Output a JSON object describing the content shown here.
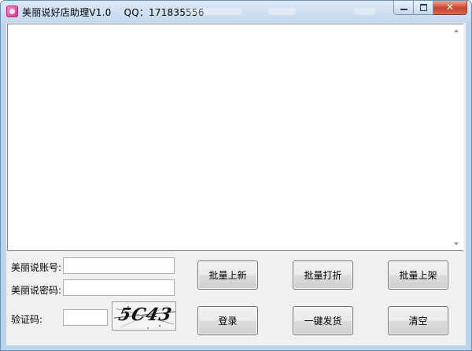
{
  "window": {
    "title": "美丽说好店助理V1.0    QQ：171835556",
    "controls": {
      "minimize": "minimize",
      "maximize": "maximize",
      "close": "✕"
    }
  },
  "output": {
    "text": ""
  },
  "form": {
    "account_label": "美丽说账号:",
    "account_value": "",
    "password_label": "美丽说密码:",
    "password_value": "",
    "captcha_label": "验证码:",
    "captcha_value": "",
    "captcha_image_text": "5C43"
  },
  "buttons": {
    "batch_new": "批量上新",
    "batch_discount": "批量打折",
    "batch_shelve": "批量上架",
    "login": "登录",
    "one_click_ship": "一键发货",
    "clear": "清空"
  },
  "icons": {
    "app": "app-icon",
    "scroll_up": "scroll-up-arrow-icon",
    "scroll_down": "scroll-down-arrow-icon"
  }
}
